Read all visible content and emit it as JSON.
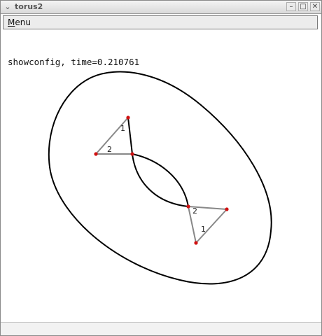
{
  "window": {
    "title": "torus2",
    "menu_icon": "chevron-down-icon",
    "buttons": {
      "minimize": "minimize-icon",
      "maximize": "maximize-icon",
      "close": "close-icon"
    }
  },
  "menubar": {
    "menu_label_first": "M",
    "menu_label_rest": "enu"
  },
  "canvas": {
    "status": "showconfig, time=0.210761",
    "segment_labels": [
      "1",
      "2",
      "2",
      "1"
    ],
    "colors": {
      "torus_stroke": "#000000",
      "edge_stroke": "#888888",
      "vertex_fill": "#d01010"
    }
  }
}
